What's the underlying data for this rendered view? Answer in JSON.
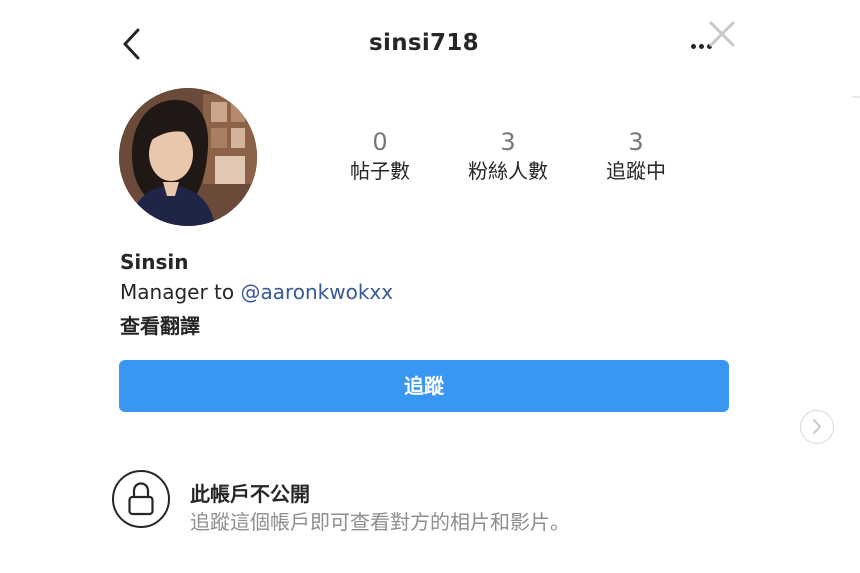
{
  "header": {
    "username": "sinsi718"
  },
  "profile": {
    "stats": [
      {
        "count": "0",
        "label": "帖子數"
      },
      {
        "count": "3",
        "label": "粉絲人數"
      },
      {
        "count": "3",
        "label": "追蹤中"
      }
    ],
    "name": "Sinsin",
    "bio_prefix": "Manager to ",
    "bio_mention": "@aaronkwokxx",
    "see_translation": "查看翻譯"
  },
  "follow_button": {
    "label": "追蹤"
  },
  "private_notice": {
    "title": "此帳戶不公開",
    "description": "追蹤這個帳戶即可查看對方的相片和影片。"
  },
  "colors": {
    "follow_button": "#3897f0",
    "mention_link": "#385898",
    "secondary_text": "#8e8e8e"
  }
}
